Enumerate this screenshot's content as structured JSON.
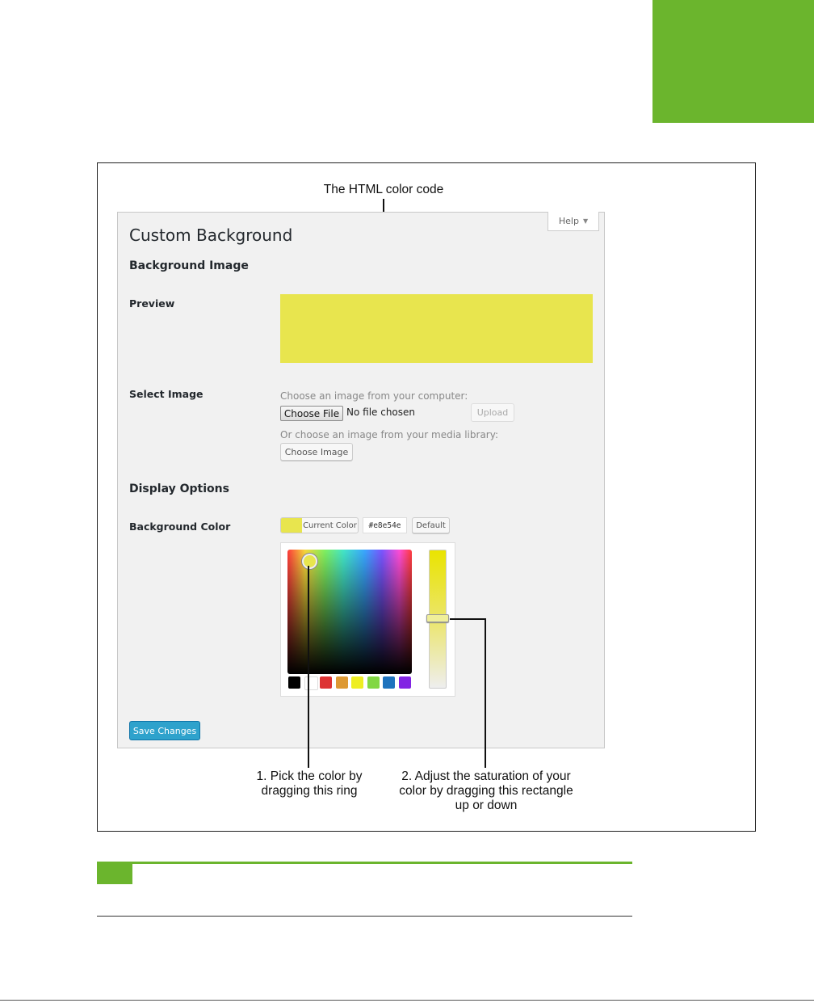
{
  "callouts": {
    "html_color_code": "The HTML color code",
    "pick_color": [
      "1. Pick the color by",
      "dragging this ring"
    ],
    "adjust_saturation": [
      "2. Adjust the saturation of your",
      "color by dragging this rectangle",
      "up or down"
    ]
  },
  "help": {
    "label": "Help"
  },
  "page": {
    "title": "Custom Background"
  },
  "background_image": {
    "section_title": "Background Image",
    "preview_label": "Preview",
    "preview_color": "#e8e54e",
    "select_label": "Select Image",
    "computer_hint": "Choose an image from your computer:",
    "choose_file_label": "Choose File",
    "no_file_text": "No file chosen",
    "upload_label": "Upload",
    "library_hint": "Or choose an image from your media library:",
    "choose_image_label": "Choose Image"
  },
  "display_options": {
    "section_title": "Display Options",
    "bg_color_label": "Background Color",
    "current_color_label": "Current Color",
    "hex_value": "#e8e54e",
    "default_label": "Default",
    "palette": [
      "#000000",
      "#ffffff",
      "#dd3333",
      "#dd9933",
      "#eeee22",
      "#81d742",
      "#1e73be",
      "#8224e3"
    ]
  },
  "save_label": "Save Changes",
  "colors": {
    "accent_green": "#6bb52d",
    "wp_blue": "#2ea2cc"
  }
}
